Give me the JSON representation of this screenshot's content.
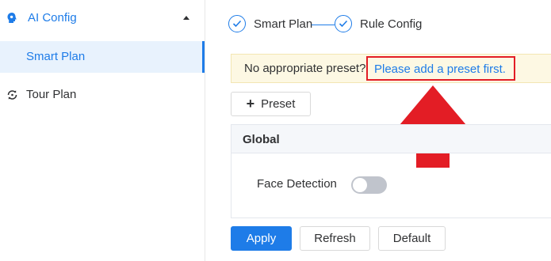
{
  "sidebar": {
    "group": {
      "label": "AI Config",
      "icon": "ai-head-icon",
      "expanded": true
    },
    "sub_items": [
      {
        "label": "Smart Plan",
        "active": true
      }
    ],
    "items": [
      {
        "label": "Tour Plan",
        "icon": "tour-loop-icon"
      }
    ]
  },
  "steps": [
    {
      "label": "Smart Plan",
      "status": "done"
    },
    {
      "label": "Rule Config",
      "status": "done"
    }
  ],
  "notice": {
    "message": "No appropriate preset?",
    "link": "Please add a preset first."
  },
  "toolbar": {
    "preset_label": "Preset",
    "preset_icon": "plus-icon"
  },
  "panel": {
    "title": "Global",
    "face_detection": {
      "label": "Face Detection",
      "enabled": false
    }
  },
  "actions": {
    "apply": "Apply",
    "refresh": "Refresh",
    "default": "Default"
  },
  "colors": {
    "accent": "#1e7ce8",
    "annotation": "#e31d25",
    "notice_bg": "#fdf8e3"
  }
}
